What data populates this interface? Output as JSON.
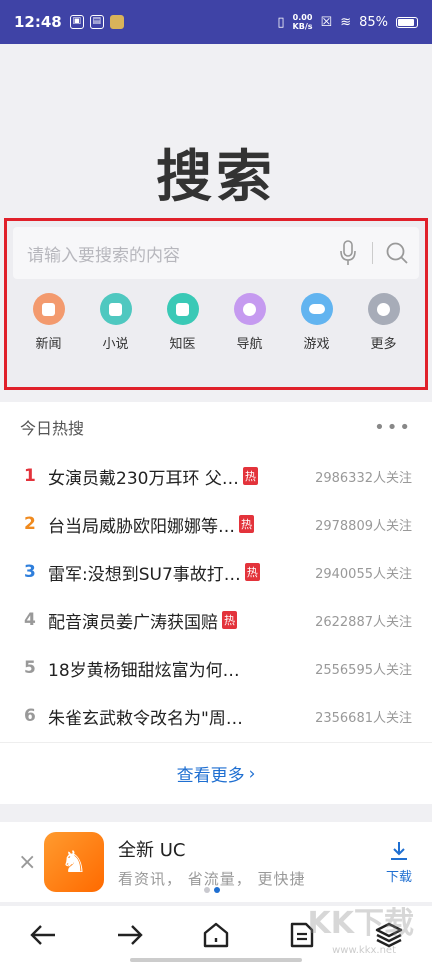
{
  "status_bar": {
    "time": "12:48",
    "net_speed_top": "0.00",
    "net_speed_unit": "KB/s",
    "battery": "85%"
  },
  "logo_text": "搜索",
  "search": {
    "placeholder": "请输入要搜索的内容"
  },
  "shortcuts": [
    {
      "label": "新闻",
      "color": "#f39a6e",
      "icon": "news-icon"
    },
    {
      "label": "小说",
      "color": "#4fc8c0",
      "icon": "novel-icon"
    },
    {
      "label": "知医",
      "color": "#3ac9b6",
      "icon": "medical-icon"
    },
    {
      "label": "导航",
      "color": "#c59af0",
      "icon": "navigation-icon"
    },
    {
      "label": "游戏",
      "color": "#62b4f0",
      "icon": "game-icon"
    },
    {
      "label": "更多",
      "color": "#a7acb8",
      "icon": "more-icon"
    }
  ],
  "hot": {
    "title": "今日热搜",
    "items": [
      {
        "rank": "1",
        "title": "女演员戴230万耳环 父…",
        "tag": "热",
        "count": "2986332人关注",
        "rank_color": "#e3333b"
      },
      {
        "rank": "2",
        "title": "台当局威胁欧阳娜娜等…",
        "tag": "热",
        "count": "2978809人关注",
        "rank_color": "#f08a1e"
      },
      {
        "rank": "3",
        "title": "雷军:没想到SU7事故打…",
        "tag": "热",
        "count": "2940055人关注",
        "rank_color": "#2f7fdc"
      },
      {
        "rank": "4",
        "title": "配音演员姜广涛获国赔",
        "tag": "热",
        "count": "2622887人关注",
        "rank_color": "#999999"
      },
      {
        "rank": "5",
        "title": "18岁黄杨钿甜炫富为何…",
        "tag": "",
        "count": "2556595人关注",
        "rank_color": "#999999"
      },
      {
        "rank": "6",
        "title": "朱雀玄武敕令改名为\"周…",
        "tag": "",
        "count": "2356681人关注",
        "rank_color": "#999999"
      }
    ],
    "view_more": "查看更多"
  },
  "banner": {
    "title": "全新 UC",
    "subtitle": "看资讯， 省流量， 更快捷",
    "download": "下载"
  },
  "watermark": {
    "main": "KK下载",
    "sub": "www.kkx.net"
  }
}
